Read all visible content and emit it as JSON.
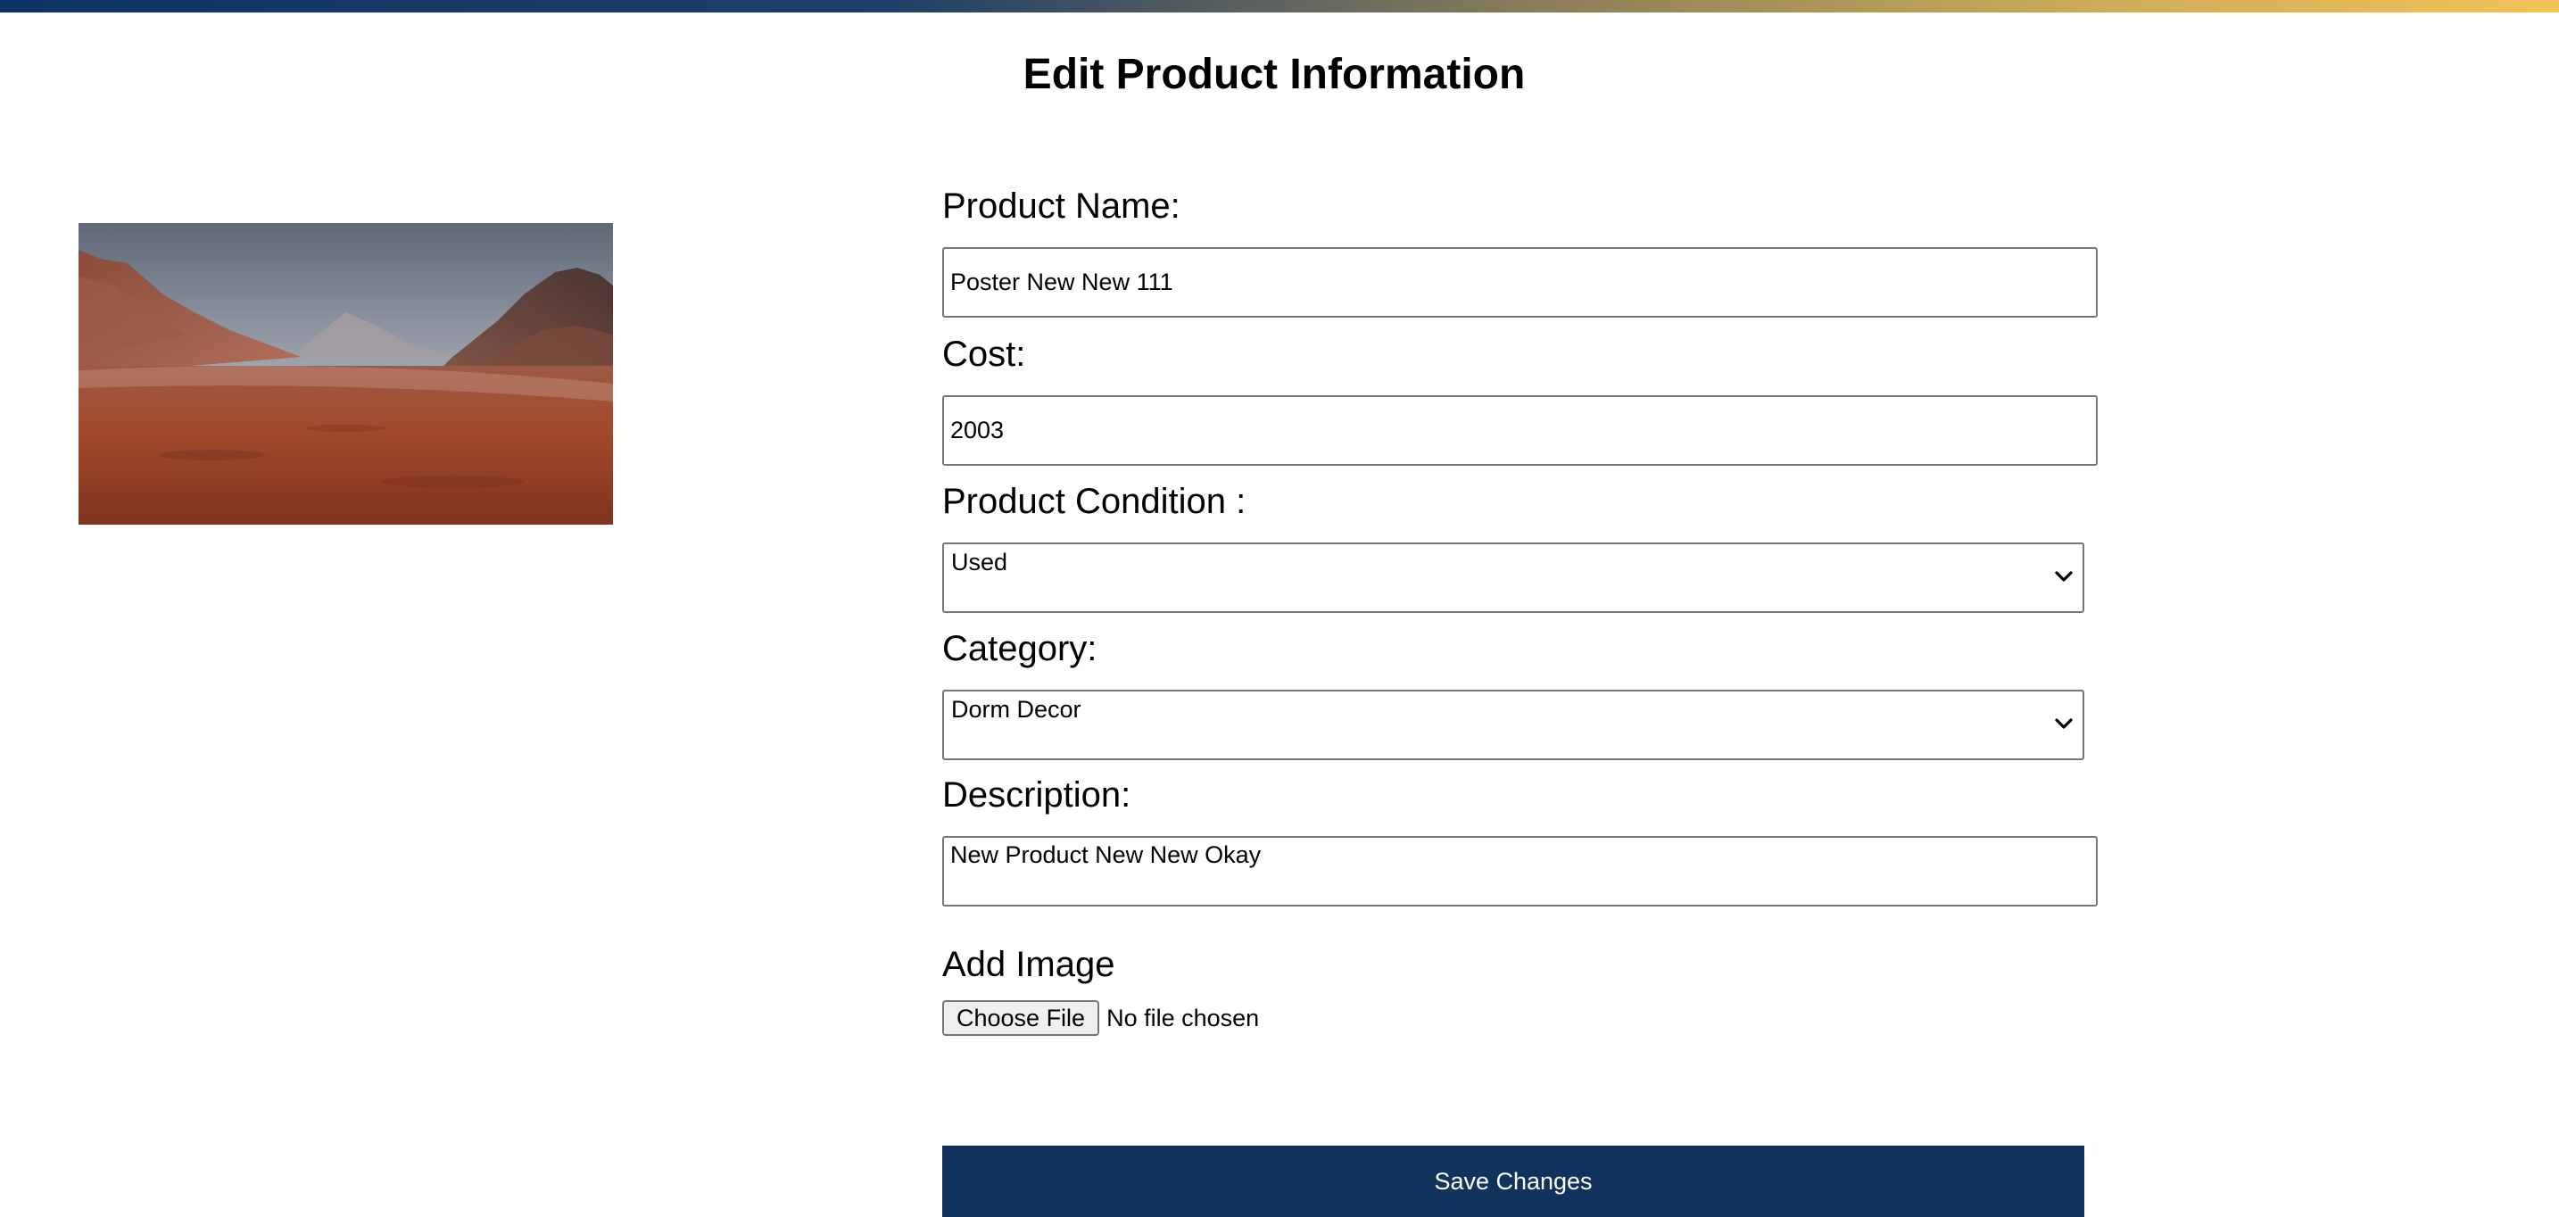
{
  "page": {
    "title": "Edit Product Information"
  },
  "form": {
    "product_name": {
      "label": "Product Name:",
      "value": "Poster New New 111"
    },
    "cost": {
      "label": "Cost:",
      "value": "2003"
    },
    "condition": {
      "label": "Product Condition :",
      "selected": "Used"
    },
    "category": {
      "label": "Category:",
      "selected": "Dorm Decor"
    },
    "description": {
      "label": "Description:",
      "value": "New Product New New Okay"
    },
    "image_upload": {
      "label": "Add Image",
      "button_label": "Choose File",
      "status": "No file chosen"
    },
    "save_label": "Save Changes"
  },
  "colors": {
    "primary": "#12325e",
    "accent_gold": "#f0c35a",
    "input_border": "#767676"
  },
  "icons": {
    "select_arrow": "chevron-down-icon"
  }
}
